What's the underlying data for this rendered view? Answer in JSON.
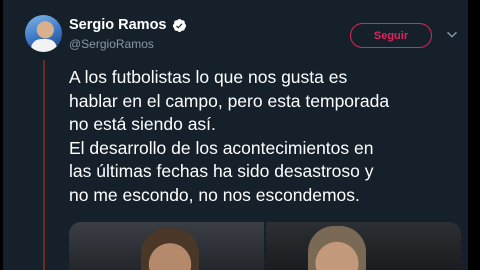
{
  "author": {
    "name": "Sergio Ramos",
    "handle": "@SergioRamos",
    "verified": true
  },
  "actions": {
    "follow_label": "Seguir"
  },
  "tweet": {
    "lines": [
      "A los futbolistas lo que nos gusta es",
      "hablar en el campo, pero esta temporada",
      "no está siendo así.",
      "El desarrollo de los acontecimientos en",
      "las últimas fechas ha sido desastroso y",
      "no me escondo, no nos escondemos."
    ]
  },
  "colors": {
    "background": "#15202b",
    "text": "#ffffff",
    "muted": "#8899a6",
    "follow_accent": "#e0245e",
    "verified_badge": "#1da1f2"
  },
  "icons": {
    "verified": "verified-badge-icon",
    "more": "chevron-down-icon"
  }
}
